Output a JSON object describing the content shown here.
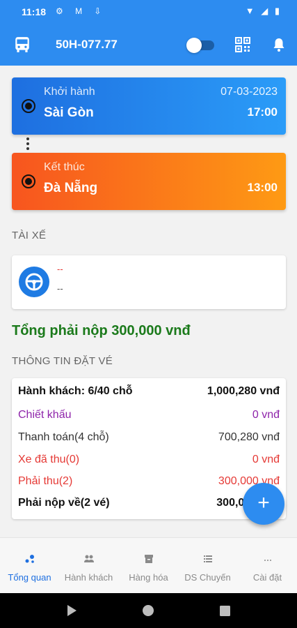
{
  "status_bar": {
    "time": "11:18"
  },
  "app_bar": {
    "plate": "50H-077.77",
    "toggle_on": false
  },
  "route": {
    "start": {
      "label": "Khởi hành",
      "city": "Sài Gòn",
      "date": "07-03-2023",
      "time": "17:00"
    },
    "end": {
      "label": "Kết thúc",
      "city": "Đà Nẵng",
      "time": "13:00"
    }
  },
  "driver": {
    "section_title": "TÀI XẾ",
    "name": "--",
    "phone": "--"
  },
  "total_due": "Tổng phải nộp 300,000 vnđ",
  "ticket_info": {
    "section_title": "THÔNG TIN ĐẶT VÉ",
    "rows": [
      {
        "label": "Hành khách: 6/40 chỗ",
        "value": "1,000,280 vnđ",
        "color": "#111111",
        "bold": true
      },
      {
        "label": "Chiết khấu",
        "value": "0 vnđ",
        "color": "#8e24aa",
        "bold": false
      },
      {
        "label": "Thanh toán(4 chỗ)",
        "value": "700,280 vnđ",
        "color": "#333333",
        "bold": false
      },
      {
        "label": "Xe đã thu(0)",
        "value": "0 vnđ",
        "color": "#e53935",
        "bold": false
      },
      {
        "label": "Phải thu(2)",
        "value": "300,000 vnđ",
        "color": "#e53935",
        "bold": false
      },
      {
        "label": "Phải nộp về(2 vé)",
        "value": "300,000 vnđ",
        "color": "#111111",
        "bold": true
      }
    ]
  },
  "fab": {
    "label": "+"
  },
  "bottom_nav": [
    {
      "label": "Tổng quan",
      "icon": "overview-icon",
      "active": true
    },
    {
      "label": "Hành khách",
      "icon": "passengers-icon",
      "active": false
    },
    {
      "label": "Hàng hóa",
      "icon": "cargo-icon",
      "active": false
    },
    {
      "label": "DS Chuyến",
      "icon": "trip-list-icon",
      "active": false
    },
    {
      "label": "Cài đặt",
      "icon": "settings-icon",
      "active": false
    }
  ],
  "colors": {
    "primary": "#2d8cf0",
    "start_card": "#1e6fe0",
    "end_card": "#fe9a14",
    "total_green": "#1b7a1b",
    "alert_red": "#e53935"
  }
}
